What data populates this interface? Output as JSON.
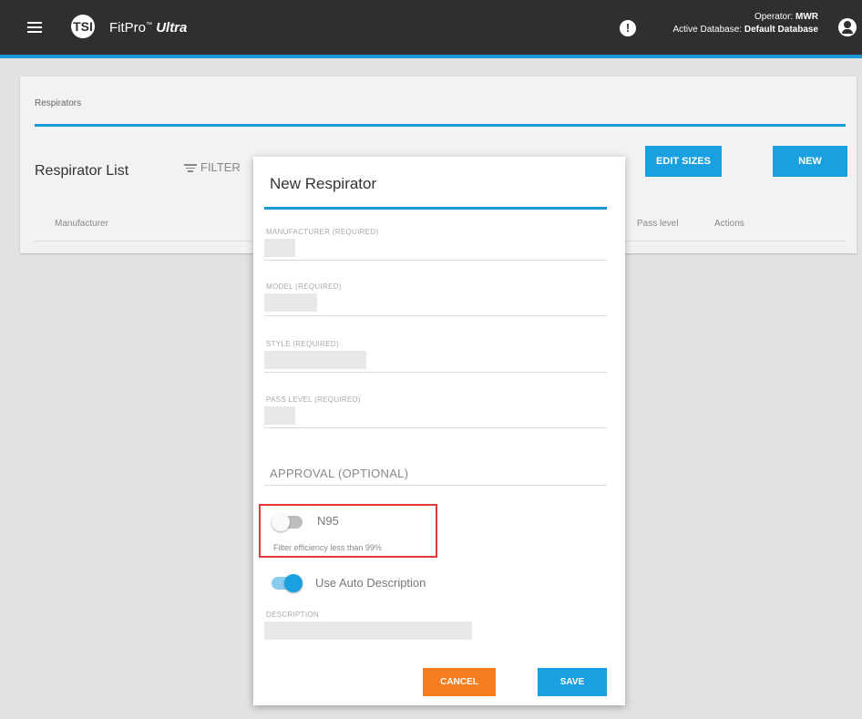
{
  "header": {
    "app_name": "FitPro",
    "app_name_suffix": "Ultra",
    "trademark": "™",
    "logo_text": "TSI",
    "operator_label": "Operator:",
    "operator_value": "MWR",
    "database_label": "Active Database:",
    "database_value": "Default Database",
    "accent_color": "#1a9ad6"
  },
  "page": {
    "breadcrumb": "Respirators",
    "list_title": "Respirator List",
    "filter_label": "FILTER",
    "edit_sizes_label": "EDIT SIZES",
    "new_label": "NEW",
    "columns": [
      "Manufacturer",
      "Pass level",
      "Actions"
    ]
  },
  "dialog": {
    "title": "New Respirator",
    "fields": [
      {
        "label": "MANUFACTURER (REQUIRED)",
        "value": ""
      },
      {
        "label": "MODEL (REQUIRED)",
        "value": ""
      },
      {
        "label": "STYLE (REQUIRED)",
        "value": ""
      },
      {
        "label": "PASS LEVEL (REQUIRED)",
        "value": ""
      }
    ],
    "approval_label": "APPROVAL (OPTIONAL)",
    "n95_label": "N95",
    "n95_checked": false,
    "n95_helper": "Filter efficiency less than 99%",
    "auto_desc_label": "Use Auto Description",
    "auto_desc_checked": true,
    "description_label": "DESCRIPTION",
    "cancel_label": "CANCEL",
    "save_label": "SAVE",
    "cancel_color": "#f57f20",
    "save_color": "#1aa0e0",
    "highlight_color": "#e03a3a"
  }
}
